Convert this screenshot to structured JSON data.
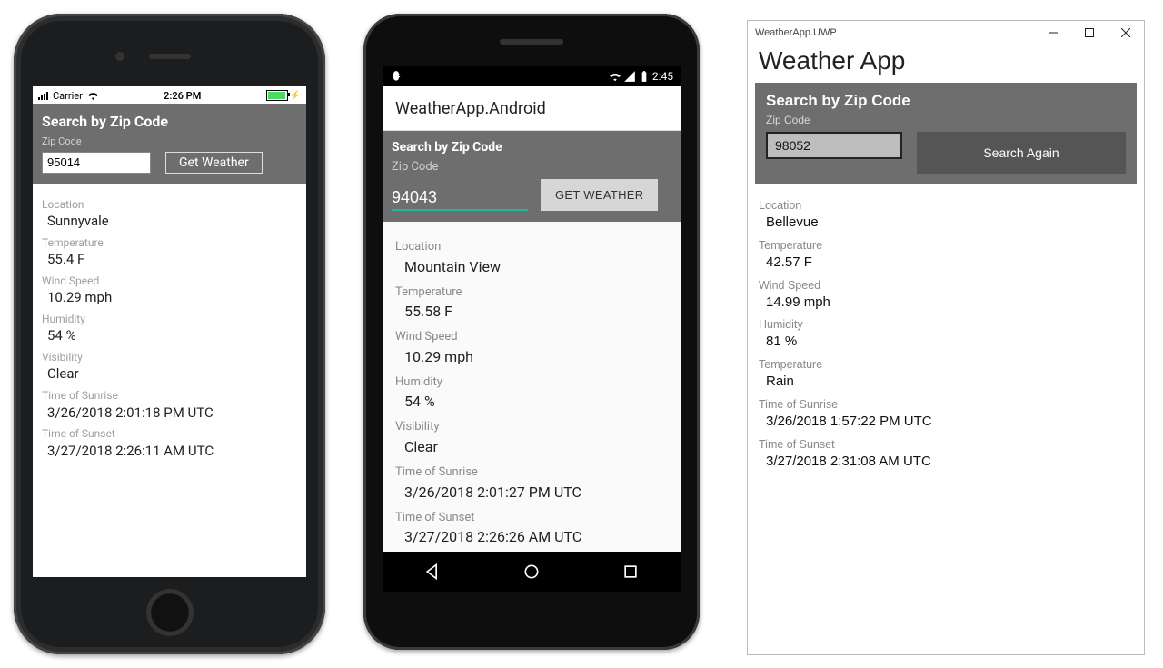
{
  "ios": {
    "status": {
      "carrier": "Carrier",
      "time": "2:26 PM"
    },
    "search_title": "Search by Zip Code",
    "zip_label": "Zip Code",
    "zip_value": "95014",
    "button_label": "Get Weather",
    "fields": {
      "location_lbl": "Location",
      "location": "Sunnyvale",
      "temp_lbl": "Temperature",
      "temp": "55.4 F",
      "wind_lbl": "Wind Speed",
      "wind": "10.29 mph",
      "humidity_lbl": "Humidity",
      "humidity": "54 %",
      "vis_lbl": "Visibility",
      "vis": "Clear",
      "sunrise_lbl": "Time of Sunrise",
      "sunrise": "3/26/2018 2:01:18 PM UTC",
      "sunset_lbl": "Time of Sunset",
      "sunset": "3/27/2018 2:26:11 AM UTC"
    }
  },
  "android": {
    "status_time": "2:45",
    "app_title": "WeatherApp.Android",
    "search_title": "Search by Zip Code",
    "zip_label": "Zip Code",
    "zip_value": "94043",
    "button_label": "GET WEATHER",
    "fields": {
      "location_lbl": "Location",
      "location": "Mountain View",
      "temp_lbl": "Temperature",
      "temp": "55.58 F",
      "wind_lbl": "Wind Speed",
      "wind": "10.29 mph",
      "humidity_lbl": "Humidity",
      "humidity": "54 %",
      "vis_lbl": "Visibility",
      "vis": "Clear",
      "sunrise_lbl": "Time of Sunrise",
      "sunrise": "3/26/2018 2:01:27 PM UTC",
      "sunset_lbl": "Time of Sunset",
      "sunset": "3/27/2018 2:26:26 AM UTC"
    }
  },
  "uwp": {
    "window_title": "WeatherApp.UWP",
    "app_title": "Weather App",
    "search_title": "Search by Zip Code",
    "zip_label": "Zip Code",
    "zip_value": "98052",
    "button_label": "Search Again",
    "fields": {
      "location_lbl": "Location",
      "location": "Bellevue",
      "temp_lbl": "Temperature",
      "temp": "42.57 F",
      "wind_lbl": "Wind Speed",
      "wind": "14.99 mph",
      "humidity_lbl": "Humidity",
      "humidity": "81 %",
      "vis_lbl": "Temperature",
      "vis": "Rain",
      "sunrise_lbl": "Time of Sunrise",
      "sunrise": "3/26/2018 1:57:22 PM UTC",
      "sunset_lbl": "Time of Sunset",
      "sunset": "3/27/2018 2:31:08 AM UTC"
    }
  }
}
